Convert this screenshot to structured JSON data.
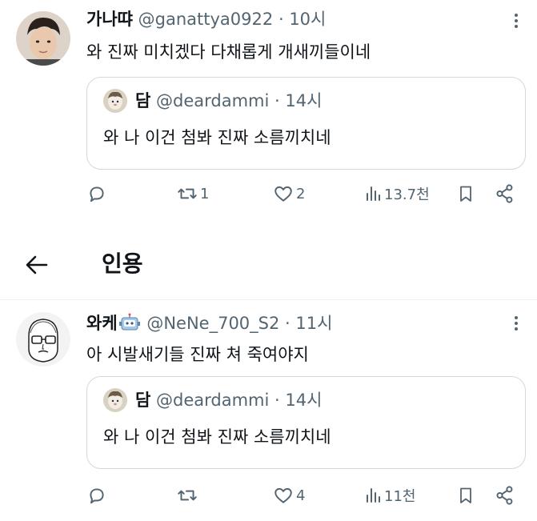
{
  "tweet1": {
    "name": "가나땨",
    "handle": "@ganattya0922",
    "dot": "·",
    "time": "10시",
    "text": "와 진짜 미치겠다 다채롭게 개새끼들이네",
    "quote": {
      "name": "담",
      "handle": "@deardammi",
      "dot": "·",
      "time": "14시",
      "text": "와 나 이건 첨봐 진짜 소름끼치네"
    },
    "actions": {
      "reply": "",
      "retweet": "1",
      "like": "2",
      "views": "13.7천"
    }
  },
  "section": {
    "title": "인용"
  },
  "tweet2": {
    "name": "와케",
    "handle": "@NeNe_700_S2",
    "dot": "·",
    "time": "11시",
    "text": "아 시발새기들 진짜 쳐 죽여야지",
    "quote": {
      "name": "담",
      "handle": "@deardammi",
      "dot": "·",
      "time": "14시",
      "text": "와 나 이건 첨봐 진짜 소름끼치네"
    },
    "actions": {
      "reply": "",
      "retweet": "",
      "like": "4",
      "views": "11천"
    }
  },
  "icons": {
    "reply": "reply-icon",
    "retweet": "retweet-icon",
    "like": "heart-icon",
    "views": "views-icon",
    "bookmark": "bookmark-icon",
    "share": "share-icon",
    "more": "more-icon",
    "back": "back-arrow-icon"
  },
  "colors": {
    "text": "#0f1419",
    "secondary": "#536471",
    "border": "#cfd9de"
  }
}
